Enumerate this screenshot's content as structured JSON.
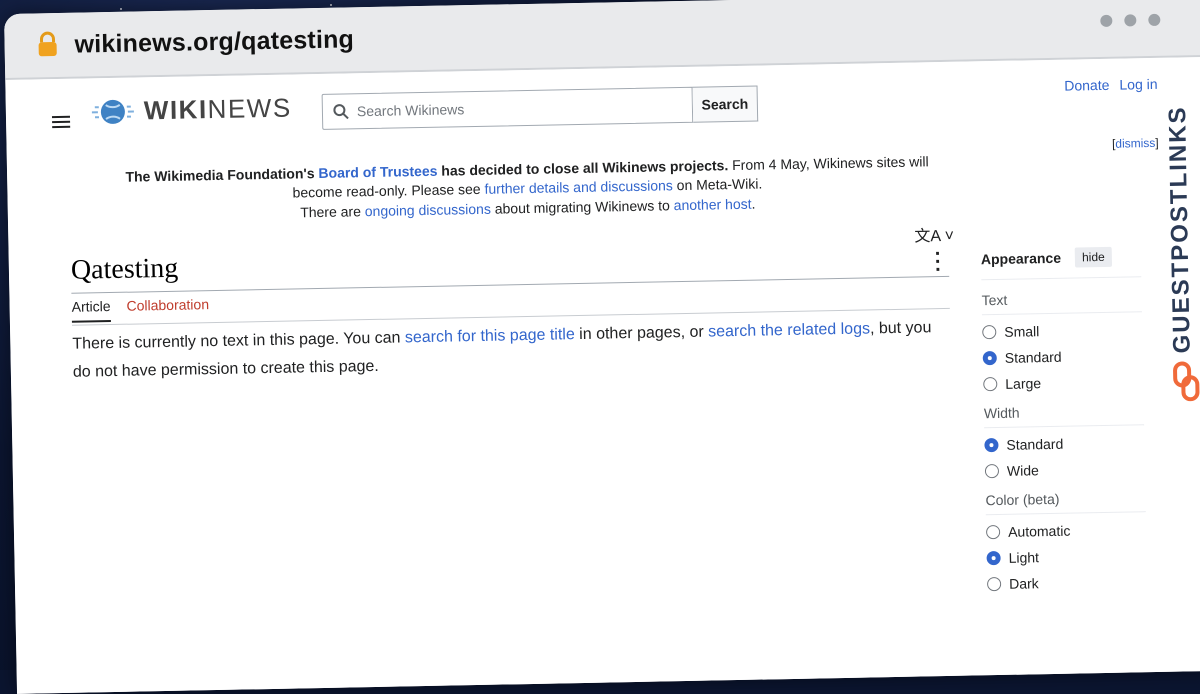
{
  "browser": {
    "url": "wikinews.org/qatesting"
  },
  "site": {
    "logo_prefix": "WIKI",
    "logo_suffix": "NEWS",
    "search_placeholder": "Search Wikinews",
    "search_button": "Search",
    "donate": "Donate",
    "login": "Log in"
  },
  "notice": {
    "dismiss": "dismiss",
    "line1_a": "The Wikimedia Foundation's ",
    "line1_link": "Board of Trustees",
    "line1_b": " has decided to close all Wikinews projects.",
    "line1_c": " From 4 May, Wikinews sites will become read-only. Please see ",
    "line1_link2": "further details and discussions",
    "line1_d": " on Meta-Wiki.",
    "line2_a": "There are ",
    "line2_link": "ongoing discussions",
    "line2_b": " about migrating Wikinews to ",
    "line2_link2": "another host",
    "line2_c": "."
  },
  "article": {
    "title": "Qatesting",
    "tab_article": "Article",
    "tab_collab": "Collaboration",
    "text_a": "There is currently no text in this page. You can ",
    "link_a": "search for this page title",
    "text_b": " in other pages, or ",
    "link_b": "search the related logs",
    "text_c": ", but you do not have permission to create this page."
  },
  "appearance": {
    "heading": "Appearance",
    "hide": "hide",
    "text_label": "Text",
    "text_options": [
      "Small",
      "Standard",
      "Large"
    ],
    "text_selected": "Standard",
    "width_label": "Width",
    "width_options": [
      "Standard",
      "Wide"
    ],
    "width_selected": "Standard",
    "color_label": "Color (beta)",
    "color_options": [
      "Automatic",
      "Light",
      "Dark"
    ],
    "color_selected": "Light"
  },
  "watermark": "GUESTPOSTLINKS",
  "colors": {
    "link": "#3366cc",
    "accent": "#bf3c2c",
    "watermark": "#2b3a55"
  }
}
